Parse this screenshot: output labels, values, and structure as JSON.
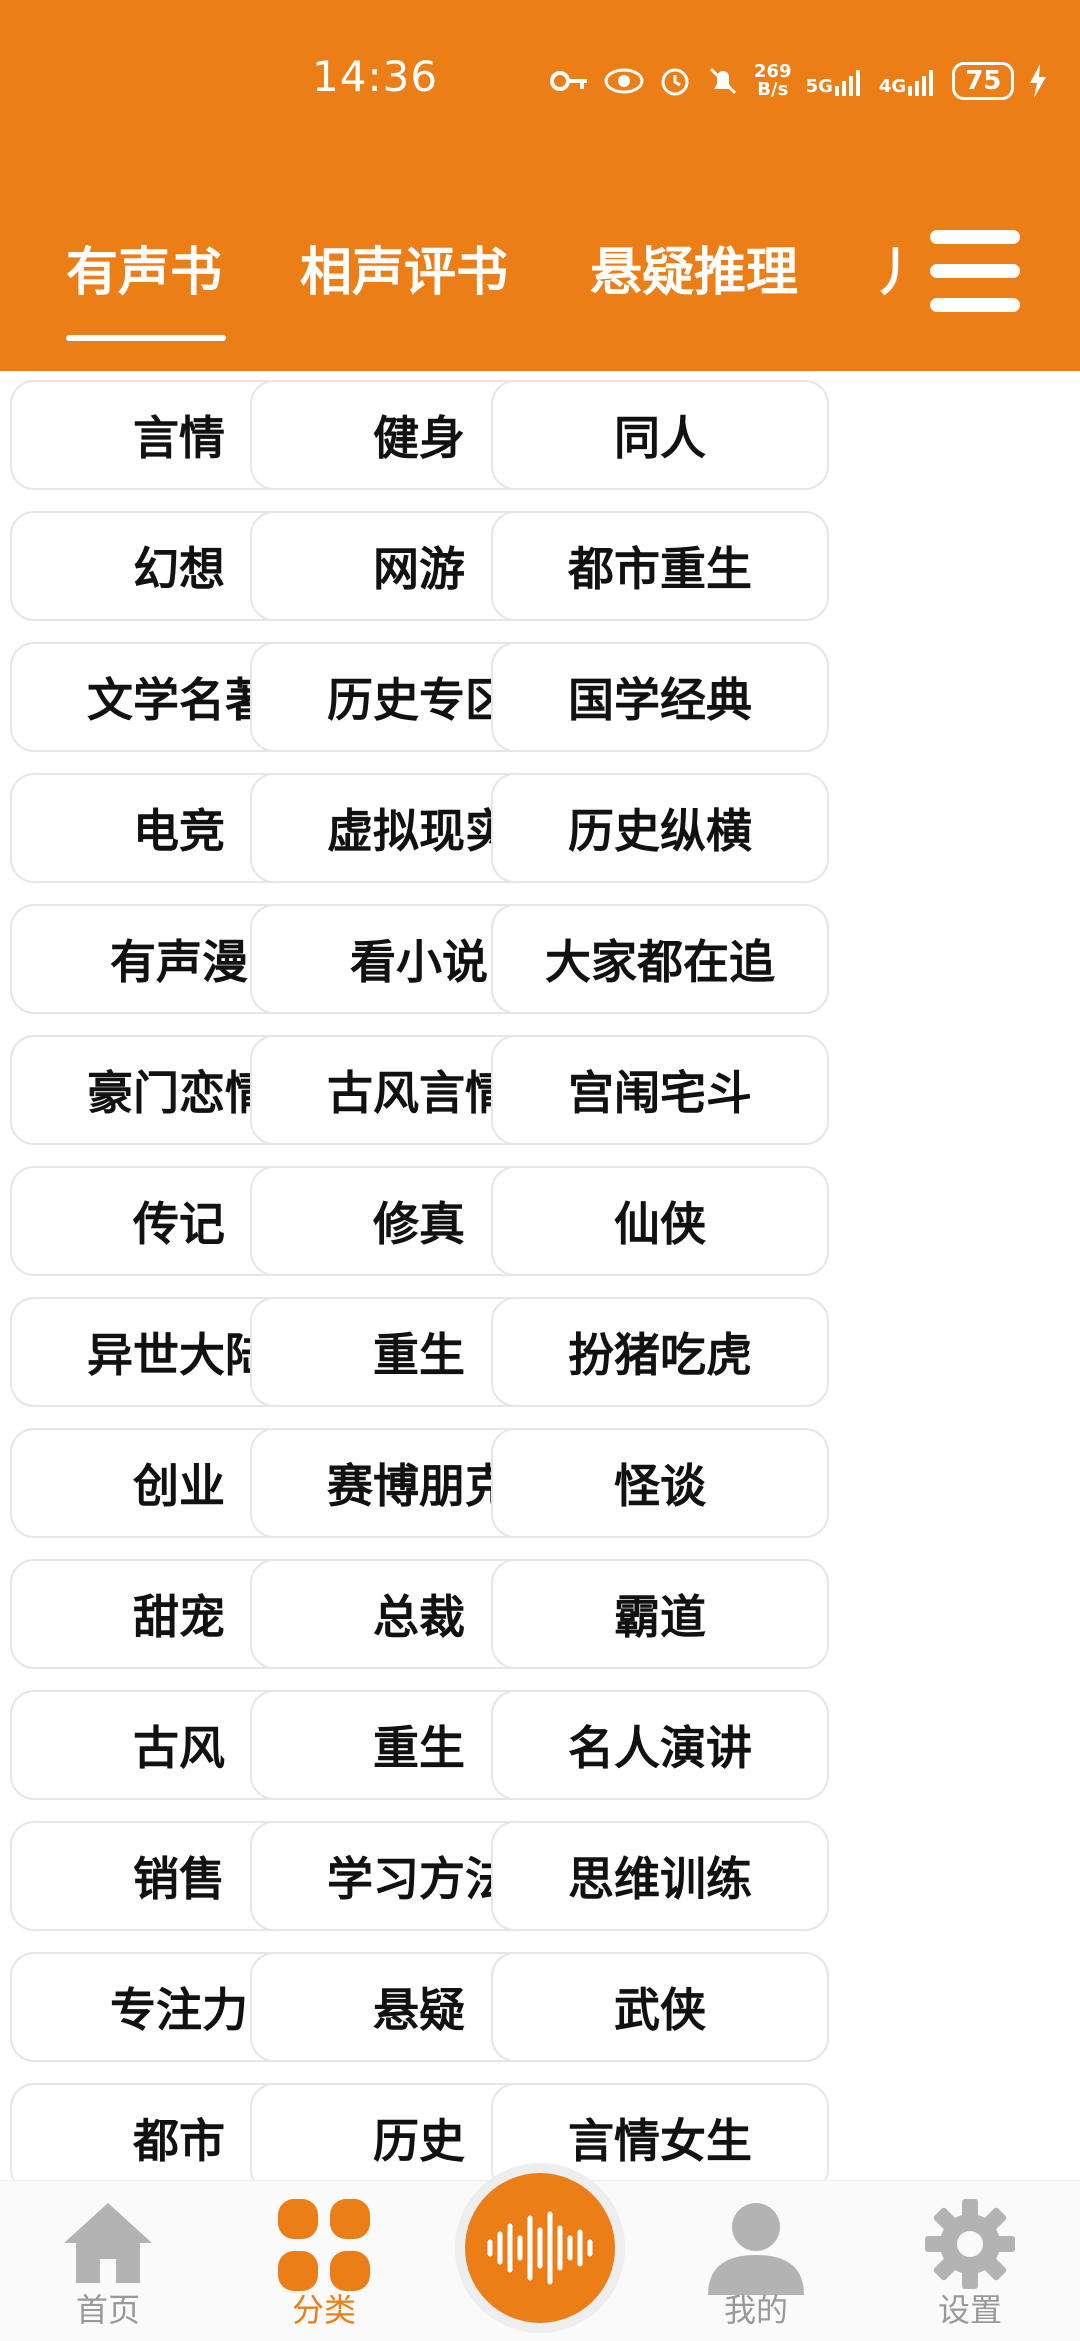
{
  "status_bar": {
    "time": "14:36",
    "net_speed_top": "269",
    "net_speed_bottom": "B/s",
    "sig1": "5G",
    "sig2": "4G",
    "battery": "75"
  },
  "tabs": [
    {
      "label": "有声书",
      "active": true
    },
    {
      "label": "相声评书",
      "active": false
    },
    {
      "label": "悬疑推理",
      "active": false
    },
    {
      "label": "儿",
      "active": false
    }
  ],
  "categories": [
    [
      "言情",
      "健身",
      "同人"
    ],
    [
      "幻想",
      "网游",
      "都市重生"
    ],
    [
      "文学名著",
      "历史专区",
      "国学经典"
    ],
    [
      "电竞",
      "虚拟现实",
      "历史纵横"
    ],
    [
      "有声漫",
      "看小说",
      "大家都在追"
    ],
    [
      "豪门恋情",
      "古风言情",
      "宫闱宅斗"
    ],
    [
      "传记",
      "修真",
      "仙侠"
    ],
    [
      "异世大陆",
      "重生",
      "扮猪吃虎"
    ],
    [
      "创业",
      "赛博朋克",
      "怪谈"
    ],
    [
      "甜宠",
      "总裁",
      "霸道"
    ],
    [
      "古风",
      "重生",
      "名人演讲"
    ],
    [
      "销售",
      "学习方法",
      "思维训练"
    ],
    [
      "专注力",
      "悬疑",
      "武侠"
    ],
    [
      "都市",
      "历史",
      "言情女生"
    ]
  ],
  "bottom_nav": [
    {
      "label": "首页",
      "icon": "home-icon"
    },
    {
      "label": "分类",
      "icon": "grid-icon"
    },
    {
      "label": "",
      "icon": "audio-wave-icon"
    },
    {
      "label": "我的",
      "icon": "person-icon"
    },
    {
      "label": "设置",
      "icon": "gear-icon"
    }
  ],
  "colors": {
    "accent": "#EC7E18",
    "inactive": "#999999"
  }
}
